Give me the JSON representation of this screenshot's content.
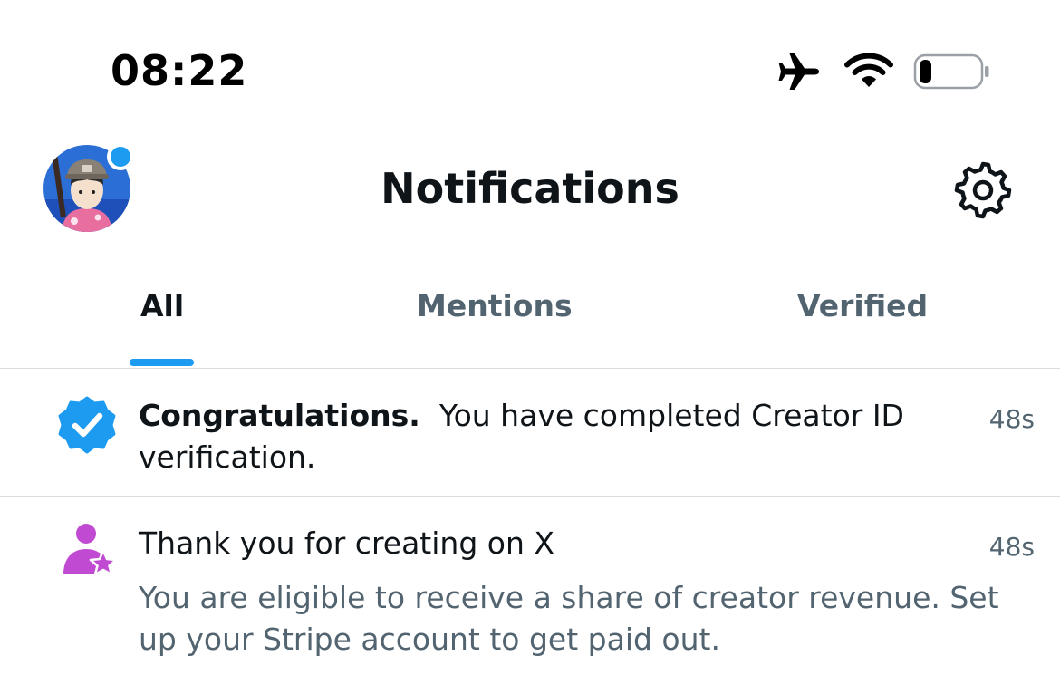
{
  "status_bar": {
    "time": "08:22",
    "icons": [
      "airplane-icon",
      "wifi-icon",
      "battery-icon"
    ],
    "battery_level": 0.2
  },
  "header": {
    "title": "Notifications",
    "avatar_icon": "user-avatar",
    "settings_icon": "gear-icon"
  },
  "tabs": [
    {
      "label": "All",
      "active": true
    },
    {
      "label": "Mentions",
      "active": false
    },
    {
      "label": "Verified",
      "active": false
    }
  ],
  "notifications": [
    {
      "icon": "verified-badge-icon",
      "bold_text": "Congratulations.",
      "text": "You have completed Creator ID verification.",
      "time": "48s"
    },
    {
      "icon": "creator-star-icon",
      "title": "Thank you for creating on X",
      "body": "You are eligible to receive a share of creator revenue. Set up your Stripe account to get paid out.",
      "time": "48s"
    }
  ],
  "colors": {
    "accent": "#1d9bf0",
    "text_primary": "#0f1419",
    "text_secondary": "#536471",
    "creator_purple": "#c14ad2",
    "divider": "#d9dde1"
  }
}
